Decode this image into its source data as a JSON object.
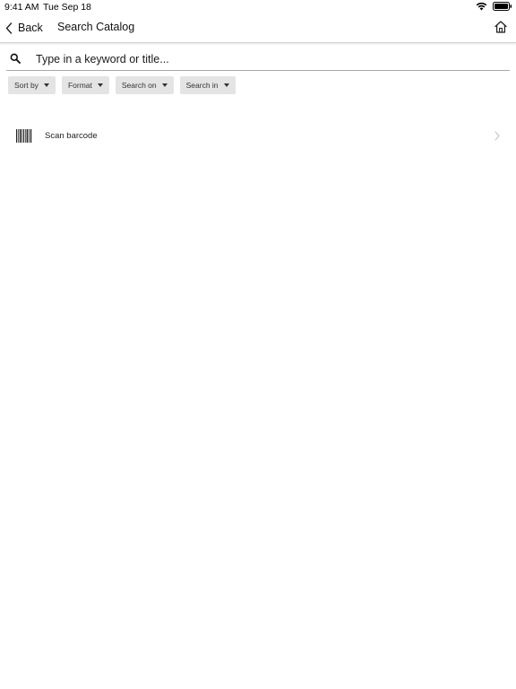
{
  "status_bar": {
    "time": "9:41 AM",
    "date": "Tue Sep 18",
    "icons": [
      "wifi-icon",
      "battery-icon"
    ]
  },
  "nav": {
    "back_label": "Back",
    "title": "Search Catalog",
    "home_icon": "home-icon"
  },
  "search": {
    "placeholder": "Type in a keyword or title...",
    "value": ""
  },
  "filters": [
    {
      "label": "Sort by"
    },
    {
      "label": "Format"
    },
    {
      "label": "Search on"
    },
    {
      "label": "Search in"
    }
  ],
  "scan": {
    "label": "Scan barcode",
    "icon": "barcode-icon"
  },
  "colors": {
    "background": "#ffffff",
    "chip_bg": "#e4e4e4",
    "text": "#111111",
    "divider": "#d6d6d6"
  }
}
